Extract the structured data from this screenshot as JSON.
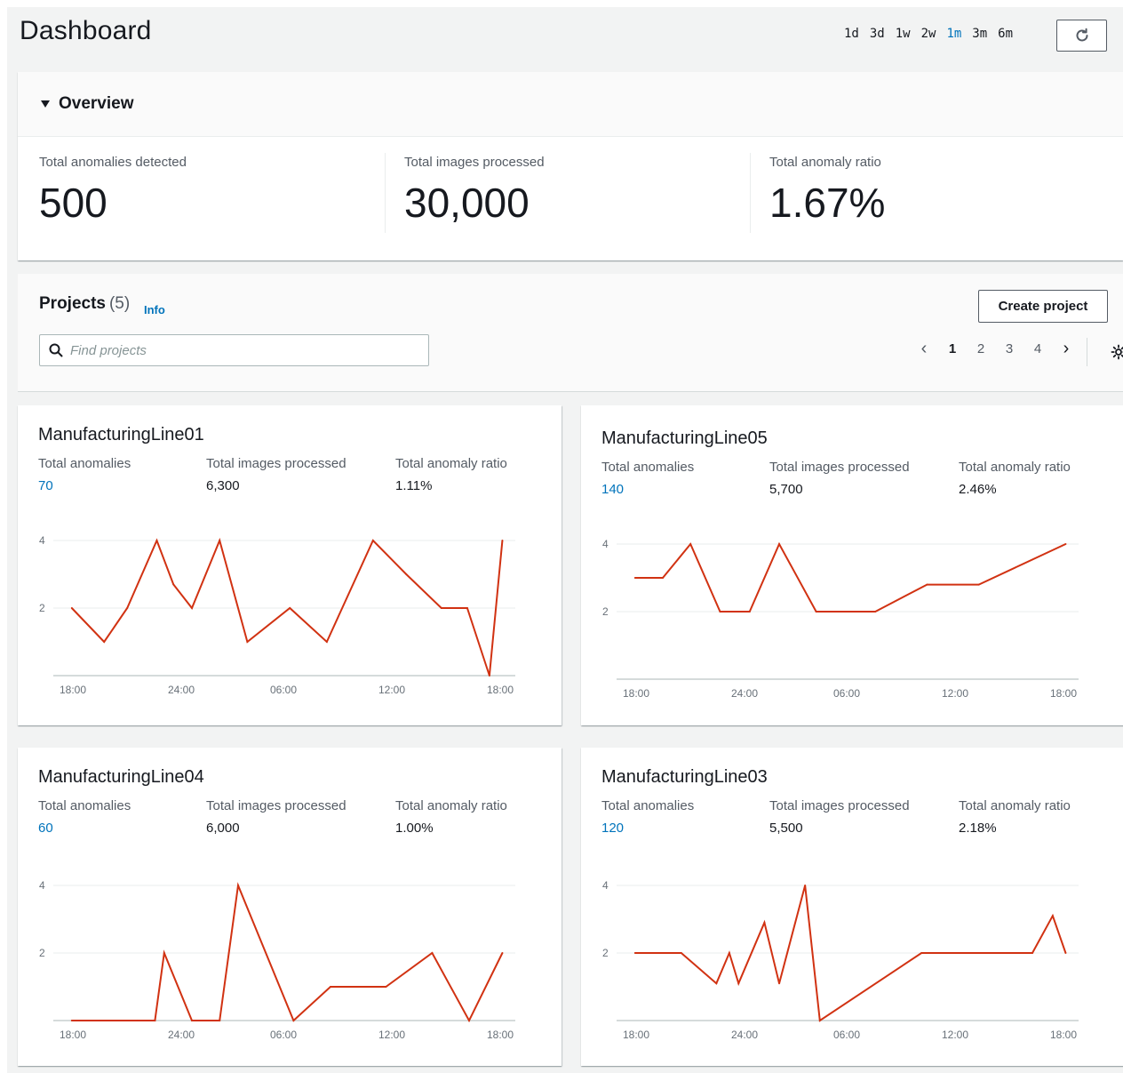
{
  "header": {
    "title": "Dashboard",
    "ranges": [
      {
        "label": "1d",
        "active": false
      },
      {
        "label": "3d",
        "active": false
      },
      {
        "label": "1w",
        "active": false
      },
      {
        "label": "2w",
        "active": false
      },
      {
        "label": "1m",
        "active": true
      },
      {
        "label": "3m",
        "active": false
      },
      {
        "label": "6m",
        "active": false
      }
    ],
    "refresh_icon": "refresh-icon"
  },
  "overview": {
    "title": "Overview",
    "metrics": [
      {
        "label": "Total anomalies detected",
        "value": "500"
      },
      {
        "label": "Total images processed",
        "value": "30,000"
      },
      {
        "label": "Total anomaly ratio",
        "value": "1.67%"
      }
    ]
  },
  "projects": {
    "title": "Projects",
    "count": "(5)",
    "info_label": "Info",
    "create_label": "Create project",
    "search_placeholder": "Find projects",
    "pages": [
      "1",
      "2",
      "3",
      "4"
    ],
    "current_page": "1"
  },
  "colors": {
    "accent": "#0073bb",
    "line": "#d13212"
  },
  "cards": [
    {
      "name": "ManufacturingLine01",
      "labels": [
        "Total anomalies",
        "Total images processed",
        "Total anomaly ratio"
      ],
      "anomalies": "70",
      "images": "6,300",
      "ratio": "1.11%"
    },
    {
      "name": "ManufacturingLine05",
      "labels": [
        "Total anomalies",
        "Total images processed",
        "Total anomaly ratio"
      ],
      "anomalies": "140",
      "images": "5,700",
      "ratio": "2.46%"
    },
    {
      "name": "ManufacturingLine04",
      "labels": [
        "Total anomalies",
        "Total images processed",
        "Total anomaly ratio"
      ],
      "anomalies": "60",
      "images": "6,000",
      "ratio": "1.00%"
    },
    {
      "name": "ManufacturingLine03",
      "labels": [
        "Total anomalies",
        "Total images processed",
        "Total anomaly ratio"
      ],
      "anomalies": "120",
      "images": "5,500",
      "ratio": "2.18%"
    }
  ],
  "chart_data": [
    {
      "type": "line",
      "project": "ManufacturingLine01",
      "x_ticks": [
        "18:00",
        "24:00",
        "06:00",
        "12:00",
        "18:00"
      ],
      "y_ticks": [
        "2",
        "4"
      ],
      "ylim": [
        0,
        4
      ],
      "x": [
        0.5,
        2.25,
        3.5,
        5.1,
        6.0,
        7.0,
        8.5,
        10.0,
        12.3,
        14.3,
        16.8,
        18.6,
        20.5,
        21.9,
        23.1,
        23.8
      ],
      "values": [
        2,
        1,
        2,
        4,
        2.7,
        2,
        4,
        1,
        2,
        1,
        4,
        3,
        2,
        2,
        0,
        4
      ],
      "xlim": [
        -0.5,
        24.5
      ]
    },
    {
      "type": "line",
      "project": "ManufacturingLine05",
      "x_ticks": [
        "18:00",
        "24:00",
        "06:00",
        "12:00",
        "18:00"
      ],
      "y_ticks": [
        "2",
        "4"
      ],
      "ylim": [
        0,
        4
      ],
      "x": [
        0.5,
        2.0,
        3.5,
        5.1,
        6.7,
        8.3,
        10.3,
        13.5,
        16.3,
        19.1,
        23.8
      ],
      "values": [
        3,
        3,
        4,
        2,
        2,
        4,
        2,
        2,
        2.8,
        2.8,
        4
      ],
      "xlim": [
        -0.5,
        24.5
      ]
    },
    {
      "type": "line",
      "project": "ManufacturingLine04",
      "x_ticks": [
        "18:00",
        "24:00",
        "06:00",
        "12:00",
        "18:00"
      ],
      "y_ticks": [
        "2",
        "4"
      ],
      "ylim": [
        0,
        4
      ],
      "x": [
        0.5,
        2.0,
        4.0,
        5.0,
        5.5,
        7.0,
        8.5,
        9.5,
        12.5,
        14.5,
        17.5,
        20.0,
        22.0,
        23.8
      ],
      "values": [
        0,
        0,
        0,
        0,
        2,
        0,
        0,
        4,
        0,
        1,
        1,
        2,
        0,
        2
      ],
      "xlim": [
        -0.5,
        24.5
      ]
    },
    {
      "type": "line",
      "project": "ManufacturingLine03",
      "x_ticks": [
        "18:00",
        "24:00",
        "06:00",
        "12:00",
        "18:00"
      ],
      "y_ticks": [
        "2",
        "4"
      ],
      "ylim": [
        0,
        4
      ],
      "x": [
        0.5,
        3.0,
        4.9,
        5.6,
        6.1,
        7.5,
        8.3,
        9.7,
        10.5,
        16.0,
        22.0,
        23.1,
        23.8
      ],
      "values": [
        2,
        2,
        1.1,
        2,
        1.1,
        2.9,
        1.1,
        4,
        0,
        2,
        2,
        3.1,
        2
      ],
      "xlim": [
        -0.5,
        24.5
      ]
    }
  ]
}
